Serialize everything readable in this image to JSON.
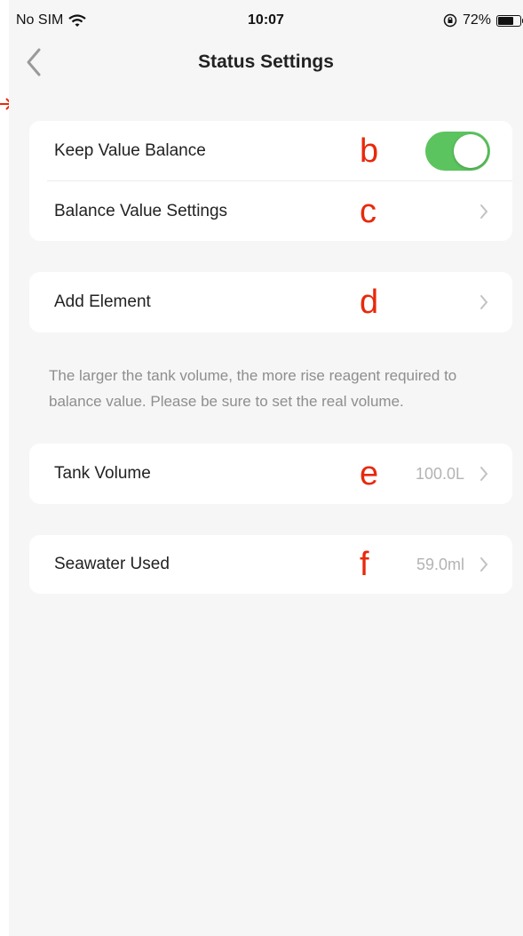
{
  "status_bar": {
    "carrier": "No SIM",
    "time": "10:07",
    "battery_percent": "72%",
    "battery_level": 0.72
  },
  "nav": {
    "title": "Status Settings"
  },
  "settings": {
    "keep_value_balance": {
      "label": "Keep Value Balance",
      "annotation": "b",
      "enabled": true
    },
    "balance_value_settings": {
      "label": "Balance Value Settings",
      "annotation": "c"
    },
    "add_element": {
      "label": "Add Element",
      "annotation": "d"
    },
    "note": "The larger the tank volume, the more rise reagent required to balance value. Please be sure to set the real volume.",
    "tank_volume": {
      "label": "Tank Volume",
      "value": "100.0L",
      "annotation": "e"
    },
    "seawater_used": {
      "label": "Seawater Used",
      "value": "59.0ml",
      "annotation": "f"
    }
  },
  "colors": {
    "toggle_on": "#5cc45f",
    "annotation": "#e8290b",
    "background": "#f6f6f6",
    "card": "#ffffff"
  }
}
